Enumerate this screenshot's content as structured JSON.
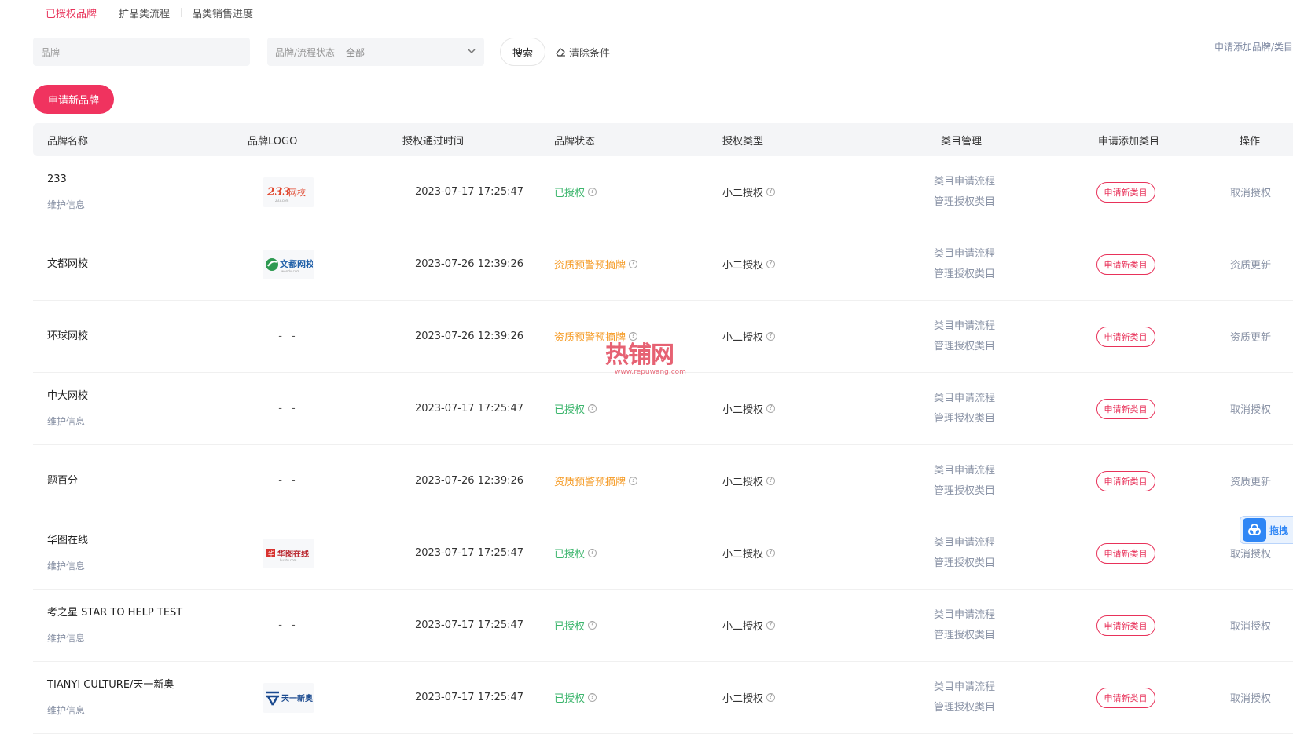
{
  "tabs": [
    {
      "label": "已授权品牌",
      "active": true
    },
    {
      "label": "扩品类流程",
      "active": false
    },
    {
      "label": "品类销售进度",
      "active": false
    }
  ],
  "filters": {
    "brand_placeholder": "品牌",
    "status_label": "品牌/流程状态",
    "status_value": "全部",
    "search_label": "搜索",
    "clear_label": "清除条件"
  },
  "top_right_link": "申请添加品牌/类目",
  "new_brand_label": "申请新品牌",
  "table": {
    "headers": [
      "品牌名称",
      "品牌LOGO",
      "授权通过时间",
      "品牌状态",
      "授权类型",
      "类目管理",
      "申请添加类目",
      "操作"
    ],
    "maintain_label": "维护信息",
    "cat_link_1": "类目申请流程",
    "cat_link_2": "管理授权类目",
    "apply_label": "申请新类目",
    "rows": [
      {
        "name": "233",
        "maintain": true,
        "logo": "233网校",
        "time": "2023-07-17 17:25:47",
        "status": "已授权",
        "status_kind": "ok",
        "type": "小二授权",
        "op": "取消授权"
      },
      {
        "name": "文都网校",
        "maintain": false,
        "logo": "文都网校",
        "time": "2023-07-26 12:39:26",
        "status": "资质预警预摘牌",
        "status_kind": "warn",
        "type": "小二授权",
        "op": "资质更新"
      },
      {
        "name": "环球网校",
        "maintain": false,
        "logo": "- -",
        "time": "2023-07-26 12:39:26",
        "status": "资质预警预摘牌",
        "status_kind": "warn",
        "type": "小二授权",
        "op": "资质更新"
      },
      {
        "name": "中大网校",
        "maintain": true,
        "logo": "- -",
        "time": "2023-07-17 17:25:47",
        "status": "已授权",
        "status_kind": "ok",
        "type": "小二授权",
        "op": "取消授权"
      },
      {
        "name": "题百分",
        "maintain": false,
        "logo": "- -",
        "time": "2023-07-26 12:39:26",
        "status": "资质预警预摘牌",
        "status_kind": "warn",
        "type": "小二授权",
        "op": "资质更新"
      },
      {
        "name": "华图在线",
        "maintain": true,
        "logo": "华图在线",
        "time": "2023-07-17 17:25:47",
        "status": "已授权",
        "status_kind": "ok",
        "type": "小二授权",
        "op": "取消授权"
      },
      {
        "name": "考之星 STAR TO HELP TEST",
        "maintain": true,
        "logo": "- -",
        "time": "2023-07-17 17:25:47",
        "status": "已授权",
        "status_kind": "ok",
        "type": "小二授权",
        "op": "取消授权"
      },
      {
        "name": "TIANYI CULTURE/天一新奥",
        "maintain": true,
        "logo": "天一新奥",
        "time": "2023-07-17 17:25:47",
        "status": "已授权",
        "status_kind": "ok",
        "type": "小二授权",
        "op": "取消授权"
      }
    ]
  },
  "watermark": {
    "text": "热铺网",
    "url": "www.repuwang.com"
  },
  "float_widget_label": "拖拽",
  "colors": {
    "accent": "#e8325a",
    "ok": "#3bb56c",
    "warn": "#f59a23",
    "link": "#8a93a6"
  }
}
